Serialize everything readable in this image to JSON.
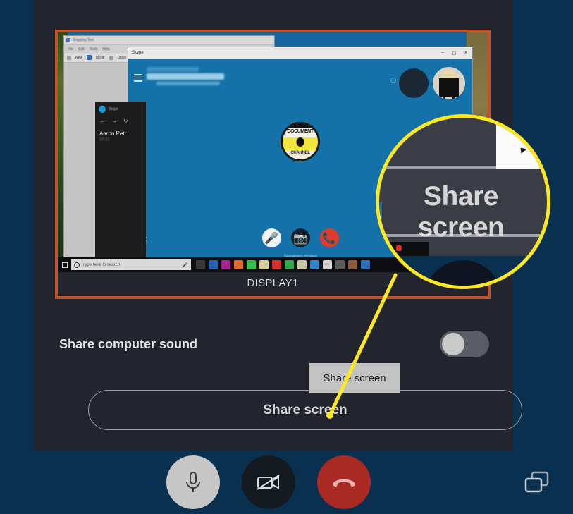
{
  "colors": {
    "app_background": "#0a3050",
    "panel_background": "#23252e",
    "selection_border": "#c2522a",
    "highlight_yellow": "#fbe722",
    "toggle_track": "#5b5d66",
    "toggle_knob": "#c9c9c9",
    "end_call_red": "#a82a22",
    "mic_button_gray": "#c6c6c6",
    "skype_blue": "#1572a8",
    "tooltip_background": "#c2c2c2"
  },
  "share_dialog": {
    "preview": {
      "display_label": "DISPLAY1",
      "selected": true,
      "snipping_tool": {
        "title": "Snipping Tool",
        "menu_items": [
          "File",
          "Edit",
          "Tools",
          "Help"
        ],
        "toolbar_items": [
          "New",
          "Mode",
          "Delay"
        ]
      },
      "notification_panel": {
        "app_name": "Skype",
        "contact_name": "Aaron Petr",
        "timestamp": "10:21"
      },
      "skype_window": {
        "title": "Skype",
        "window_controls": [
          "minimize",
          "maximize",
          "close"
        ],
        "status_text": "Speakers muted",
        "tooltip_text": "Share screen",
        "call_buttons": [
          "microphone",
          "camera-off",
          "end-call"
        ]
      },
      "taskbar": {
        "search_placeholder": "Type here to search"
      }
    },
    "sound_toggle": {
      "label": "Share computer sound",
      "state": "off"
    },
    "share_button": {
      "label": "Share screen"
    }
  },
  "annotation": {
    "tooltip_label": "Share screen",
    "magnifier": {
      "label": "Share screen",
      "highlight_color": "#fbe722"
    }
  },
  "call_controls": {
    "microphone_button": "microphone",
    "camera_button": "camera-off",
    "end_call_button": "end-call",
    "split_view_button": "split-view"
  }
}
